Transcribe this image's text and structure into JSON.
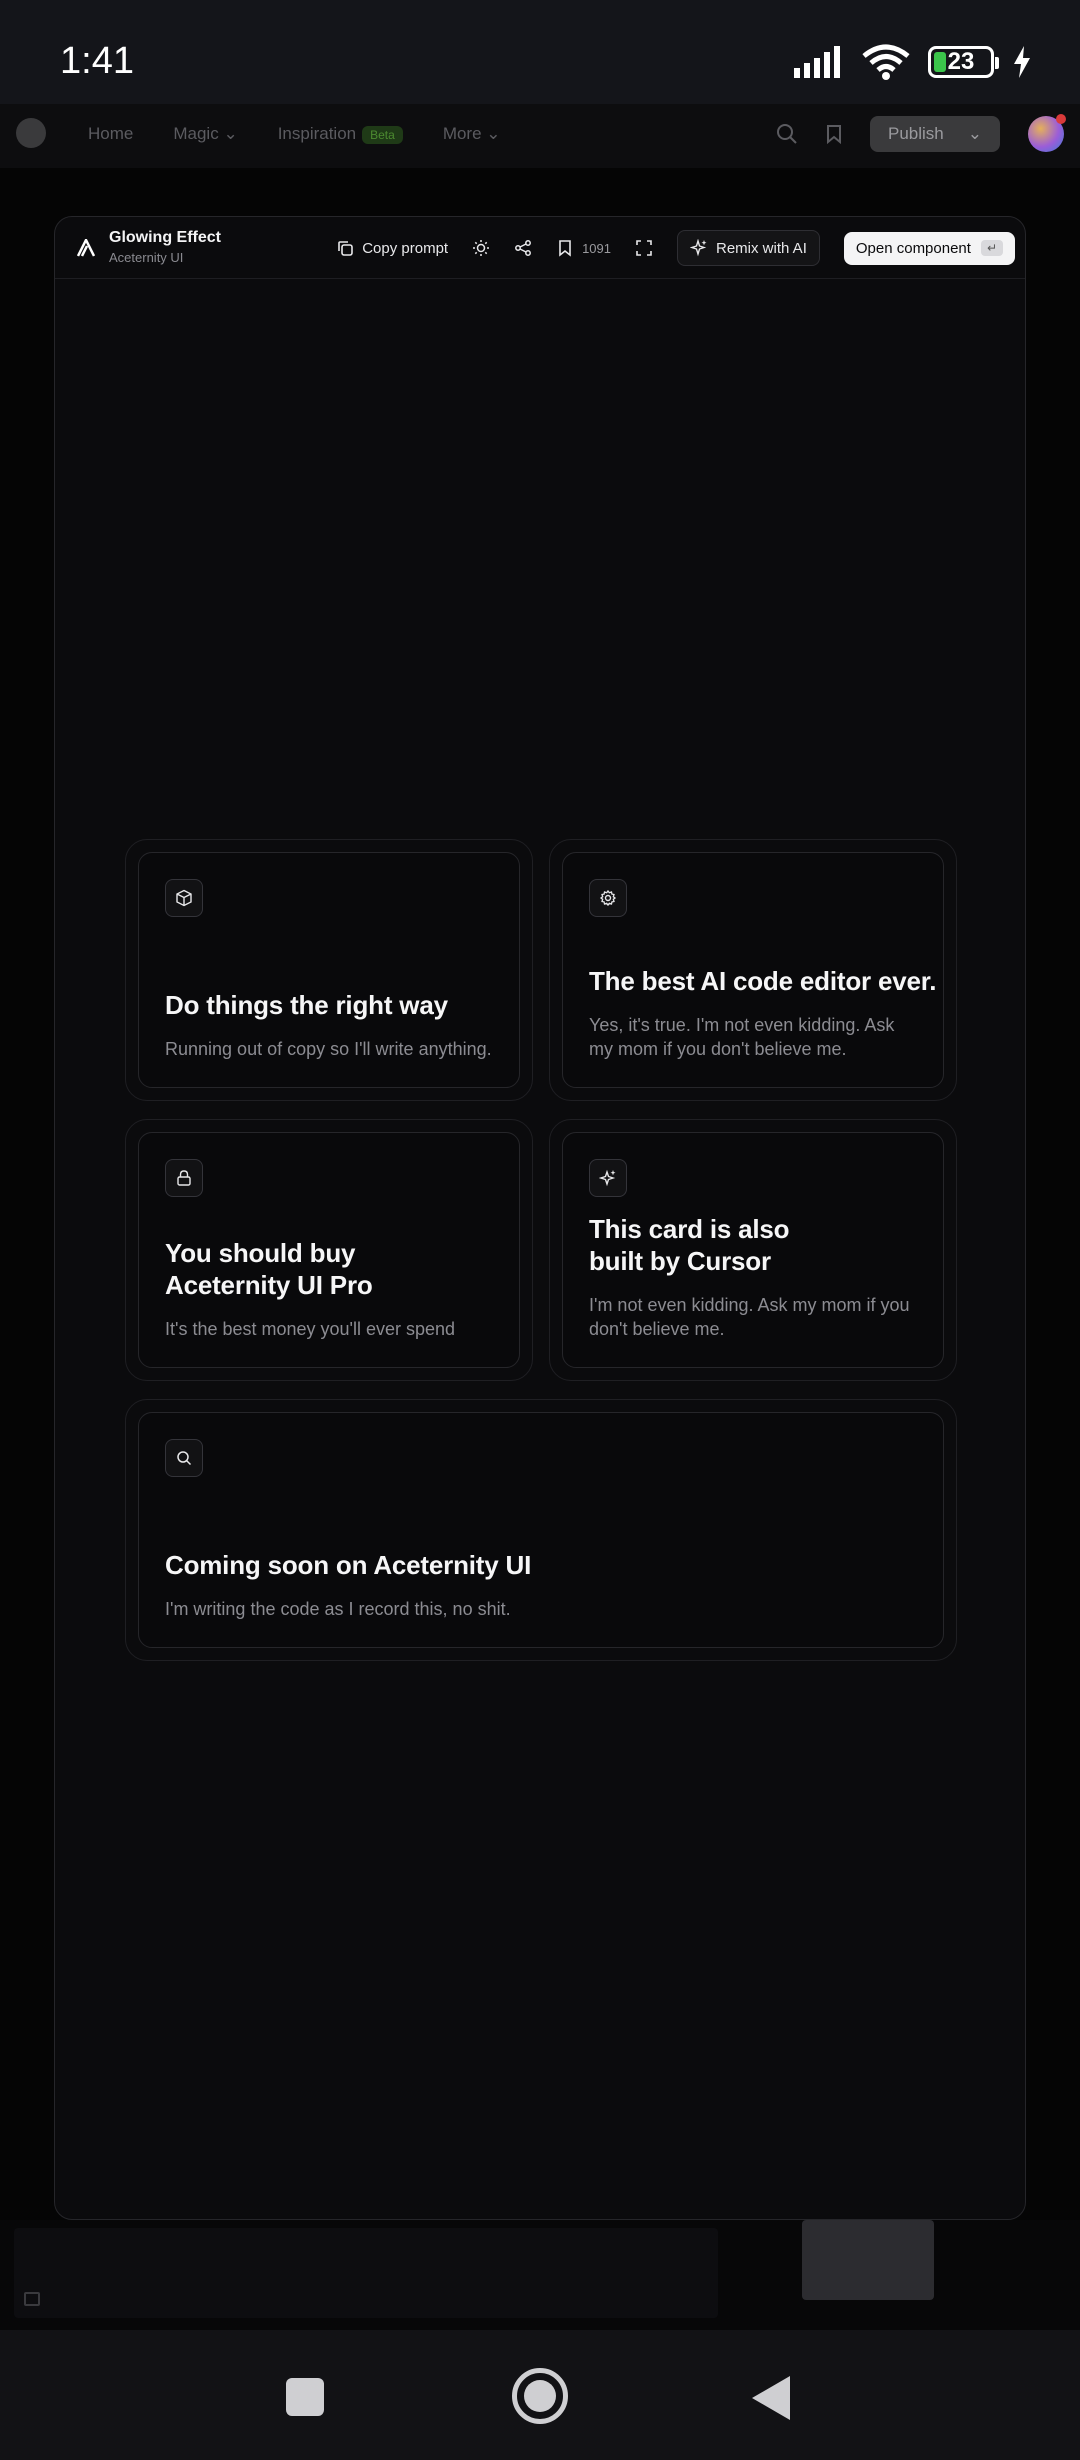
{
  "status": {
    "time": "1:41",
    "battery": "23"
  },
  "site_nav": {
    "items": [
      "Home",
      "Magic",
      "Inspiration",
      "More"
    ],
    "beta_badge": "Beta",
    "publish_label": "Publish"
  },
  "modal": {
    "title": "Glowing Effect",
    "subtitle": "Aceternity UI",
    "copy_prompt": "Copy prompt",
    "bookmark_count": "1091",
    "remix_label": "Remix with AI",
    "open_label": "Open component",
    "open_kbd": "↵"
  },
  "cards": [
    {
      "icon": "box-icon",
      "title": "Do things the right way",
      "desc": "Running out of copy so I'll write anything."
    },
    {
      "icon": "gear-icon",
      "title": "The best AI code editor ever.",
      "desc": "Yes, it's true. I'm not even kidding. Ask my mom if you don't believe me."
    },
    {
      "icon": "lock-icon",
      "title": "You should buy\nAceternity UI Pro",
      "desc": "It's the best money you'll ever spend"
    },
    {
      "icon": "sparkles-icon",
      "title": "This card is also\nbuilt by Cursor",
      "desc": "I'm not even kidding. Ask my mom if you don't believe me."
    },
    {
      "icon": "search-icon",
      "title": "Coming soon on Aceternity UI",
      "desc": "I'm writing the code as I record this, no shit."
    }
  ]
}
